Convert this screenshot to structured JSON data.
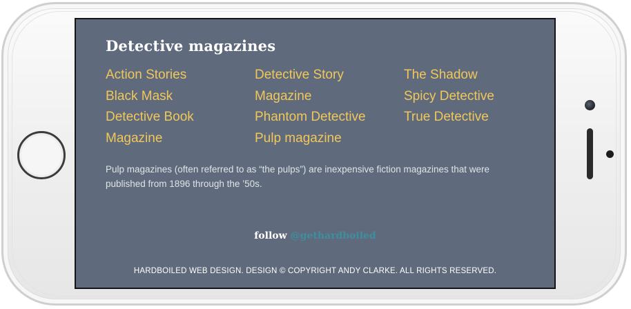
{
  "screen": {
    "title": "Detective magazines",
    "columns": [
      {
        "links": [
          {
            "label": "Action Stories"
          },
          {
            "label": "Black Mask"
          },
          {
            "label": "Detective Book"
          },
          {
            "label": "Magazine"
          }
        ]
      },
      {
        "links": [
          {
            "label": "Detective Story"
          },
          {
            "label": "Magazine"
          },
          {
            "label": "Phantom Detective"
          },
          {
            "label": "Pulp magazine"
          }
        ]
      },
      {
        "links": [
          {
            "label": "The Shadow"
          },
          {
            "label": "Spicy Detective"
          },
          {
            "label": "True Detective"
          }
        ]
      }
    ],
    "description": "Pulp magazines (often referred to as “the pulps”) are inexpensive fiction magazines that were published from 1896 through the ’50s.",
    "follow": {
      "label": "follow",
      "handle": "@gethardboiled"
    },
    "copyright": "HARDBOILED WEB DESIGN. DESIGN © COPYRIGHT ANDY CLARKE. ALL RIGHTS RESERVED."
  },
  "colors": {
    "screen_bg": "#5f6b7c",
    "link": "#f1c75a",
    "handle": "#3d8f9f",
    "text": "#dfe3e8"
  },
  "device": {
    "type": "phone",
    "orientation": "landscape",
    "icons": [
      "home-button",
      "camera-icon",
      "speaker-grille",
      "proximity-sensor"
    ]
  }
}
